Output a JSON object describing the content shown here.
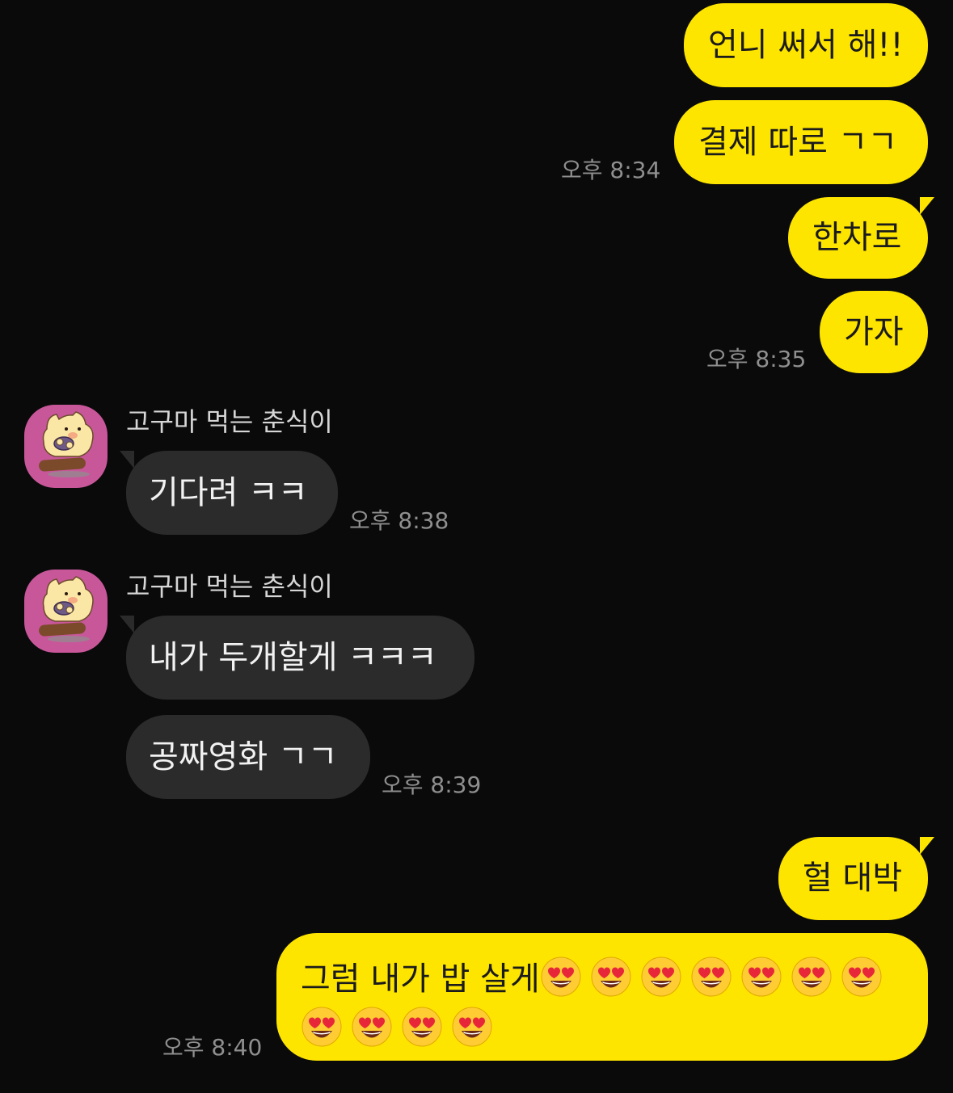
{
  "messages": {
    "m1": {
      "text": "언니 써서 해!!"
    },
    "m2": {
      "text": "결제 따로 ㄱㄱ",
      "time": "오후 8:34"
    },
    "m3": {
      "text": "한차로"
    },
    "m4": {
      "text": "가자",
      "time": "오후 8:35"
    },
    "m5": {
      "sender": "고구마 먹는 춘식이",
      "text": "기다려 ㅋㅋ",
      "time": "오후 8:38"
    },
    "m6": {
      "sender": "고구마 먹는 춘식이",
      "text": "내가 두개할게 ㅋㅋㅋ"
    },
    "m7": {
      "text": "공짜영화 ㄱㄱ",
      "time": "오후 8:39"
    },
    "m8": {
      "text": "헐 대박"
    },
    "m9": {
      "text": "그럼 내가 밥 살게",
      "emoji": "heart-eyes-emoji",
      "emoji_count": 11,
      "time": "오후 8:40"
    }
  },
  "colors": {
    "background": "#0a0a0a",
    "my_bubble": "#fee500",
    "their_bubble": "#2b2b2b",
    "avatar_bg": "#c8579a",
    "timestamp": "#8f8f8f"
  },
  "icons": {
    "avatar": "choonsik-eating-sweet-potato-avatar",
    "emoji": "heart-eyes-emoji"
  }
}
